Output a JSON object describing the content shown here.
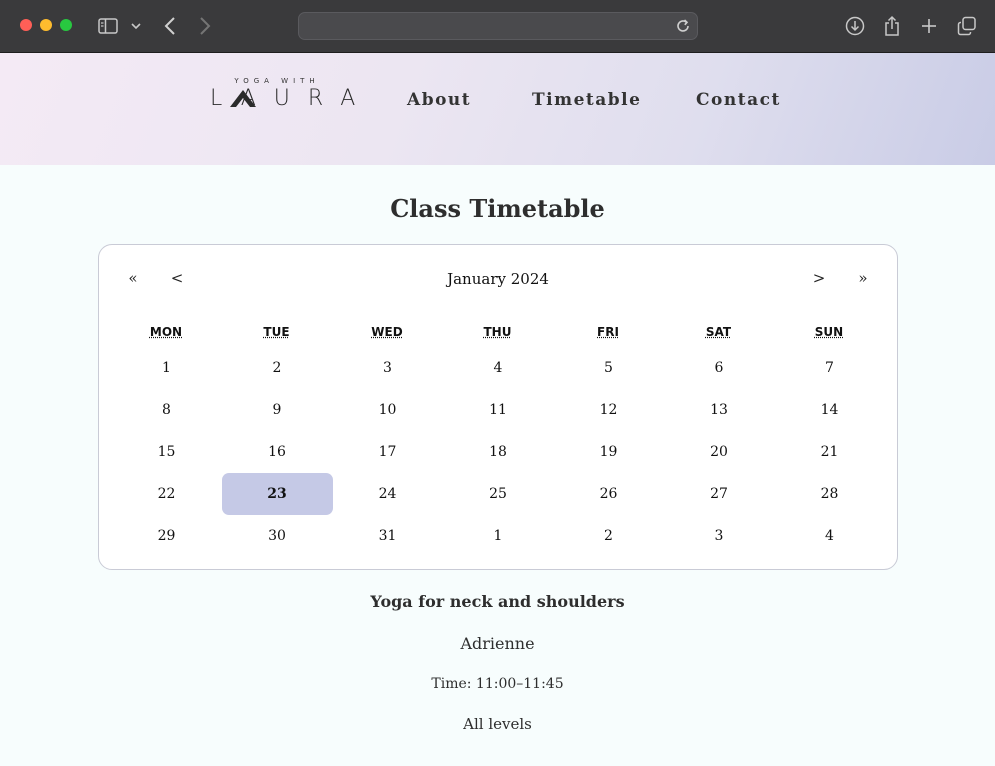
{
  "browser": {
    "url": "",
    "icons": [
      "sidebar-icon",
      "chevron-down-icon",
      "back-icon",
      "forward-icon",
      "reload-icon",
      "download-icon",
      "share-icon",
      "new-tab-icon",
      "tabs-overview-icon"
    ]
  },
  "logo": {
    "small": "YOGA WITH",
    "big": "LAURA"
  },
  "nav": [
    {
      "label": "About"
    },
    {
      "label": "Timetable"
    },
    {
      "label": "Contact"
    }
  ],
  "page": {
    "title": "Class Timetable"
  },
  "calendar": {
    "prev_year": "«",
    "prev_month": "<",
    "next_month": ">",
    "next_year": "»",
    "month_label": "January 2024",
    "weekdays": [
      "MON",
      "TUE",
      "WED",
      "THU",
      "FRI",
      "SAT",
      "SUN"
    ],
    "weeks": [
      [
        "1",
        "2",
        "3",
        "4",
        "5",
        "6",
        "7"
      ],
      [
        "8",
        "9",
        "10",
        "11",
        "12",
        "13",
        "14"
      ],
      [
        "15",
        "16",
        "17",
        "18",
        "19",
        "20",
        "21"
      ],
      [
        "22",
        "23",
        "24",
        "25",
        "26",
        "27",
        "28"
      ],
      [
        "29",
        "30",
        "31",
        "1",
        "2",
        "3",
        "4"
      ]
    ],
    "selected": "23",
    "selected_color": "#c5c9e6"
  },
  "class": {
    "title": "Yoga for neck and shoulders",
    "instructor": "Adrienne",
    "time": "Time: 11:00–11:45",
    "level": "All levels"
  }
}
